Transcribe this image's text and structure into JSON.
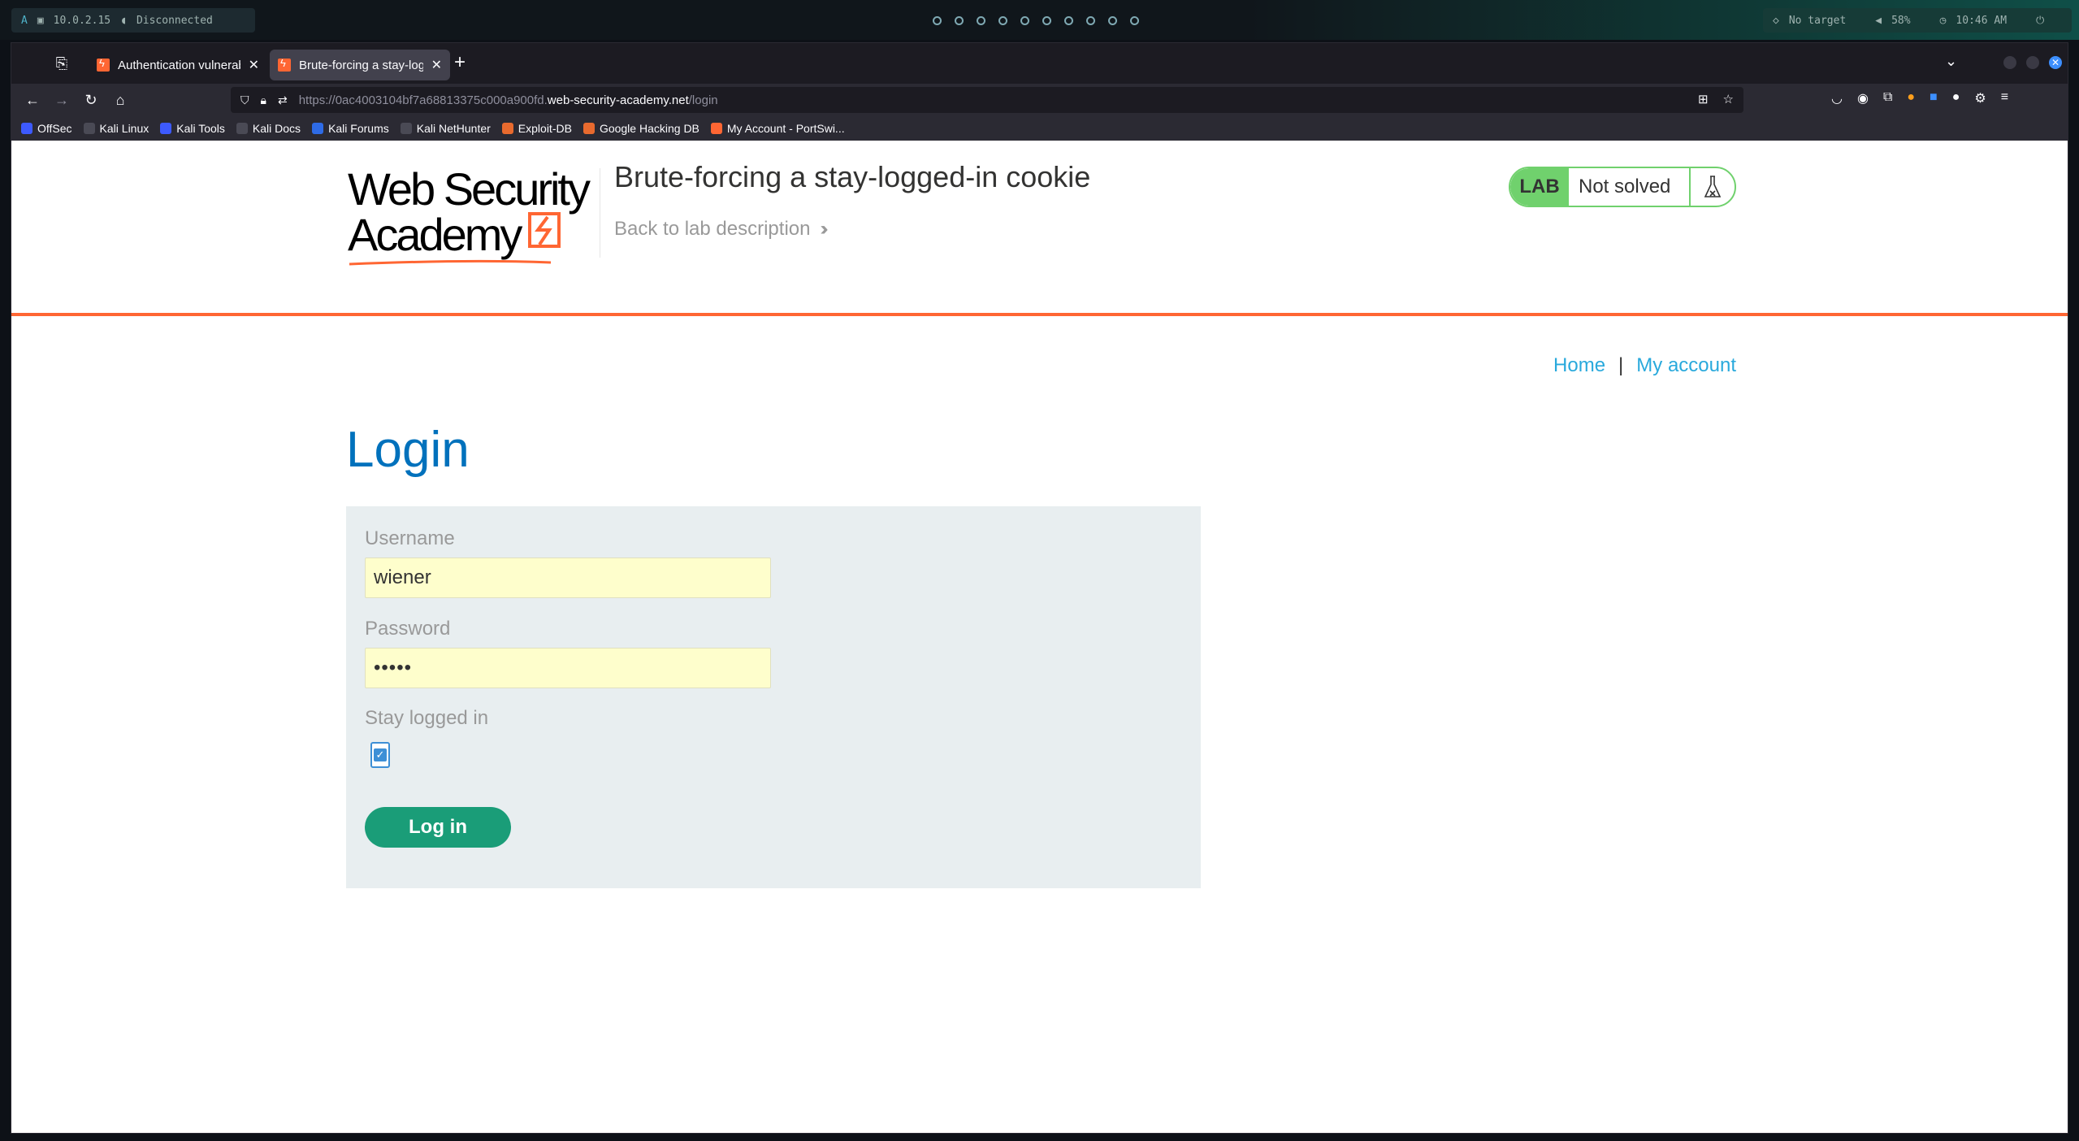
{
  "system_bar": {
    "ip": "10.0.2.15",
    "vpn_status": "Disconnected",
    "target": "No target",
    "volume": "58%",
    "time": "10:46 AM"
  },
  "browser": {
    "tabs": [
      {
        "label": "Authentication vulnerabili",
        "active": false
      },
      {
        "label": "Brute-forcing a stay-logge",
        "active": true
      }
    ],
    "url": {
      "prefix": "https://0ac4003104bf7a68813375c000a900fd.",
      "host": "web-security-academy.net",
      "path": "/login"
    },
    "bookmarks": [
      {
        "label": "OffSec",
        "color": "#3d5afe"
      },
      {
        "label": "Kali Linux",
        "color": "#4a4a55"
      },
      {
        "label": "Kali Tools",
        "color": "#3d5afe"
      },
      {
        "label": "Kali Docs",
        "color": "#4a4a55"
      },
      {
        "label": "Kali Forums",
        "color": "#2e6be6"
      },
      {
        "label": "Kali NetHunter",
        "color": "#4a4a55"
      },
      {
        "label": "Exploit-DB",
        "color": "#e86a2e"
      },
      {
        "label": "Google Hacking DB",
        "color": "#e86a2e"
      },
      {
        "label": "My Account - PortSwi...",
        "color": "#ff6633"
      }
    ]
  },
  "lab": {
    "logo_line1": "Web Security",
    "logo_line2": "Academy",
    "title": "Brute-forcing a stay-logged-in cookie",
    "back_link": "Back to lab description",
    "status_tag": "LAB",
    "status_text": "Not solved"
  },
  "nav": {
    "home": "Home",
    "separator": "|",
    "my_account": "My account"
  },
  "login": {
    "heading": "Login",
    "username_label": "Username",
    "username_value": "wiener",
    "password_label": "Password",
    "password_value": "•••••",
    "stay_logged_in_label": "Stay logged in",
    "stay_logged_in_checked": true,
    "submit_label": "Log in"
  }
}
